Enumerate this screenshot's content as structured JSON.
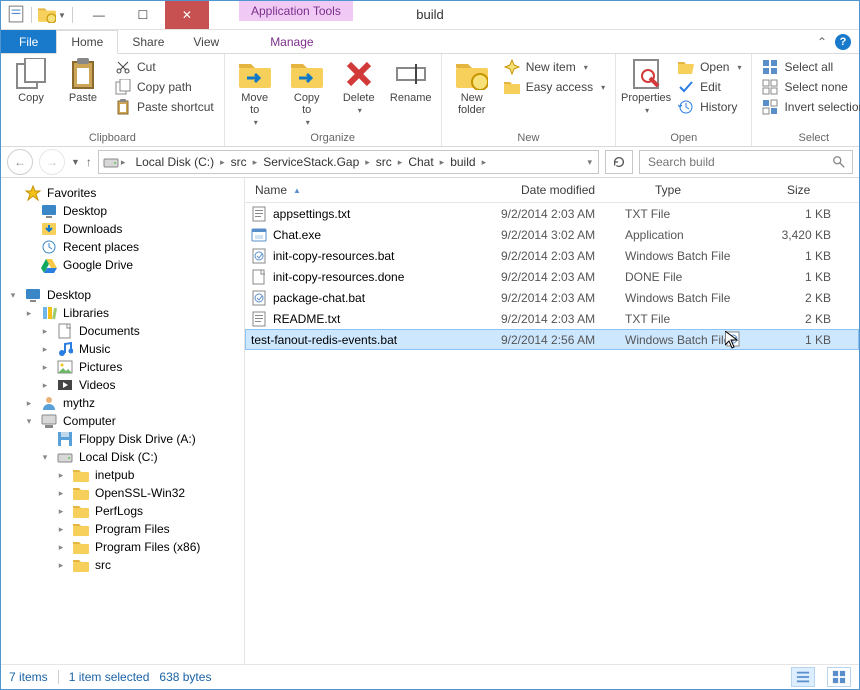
{
  "window": {
    "app_tools_label": "Application Tools",
    "title": "build"
  },
  "menubar": {
    "file": "File",
    "tabs": [
      "Home",
      "Share",
      "View"
    ],
    "manage": "Manage"
  },
  "ribbon": {
    "clipboard": {
      "label": "Clipboard",
      "copy": "Copy",
      "paste": "Paste",
      "cut": "Cut",
      "copy_path": "Copy path",
      "paste_shortcut": "Paste shortcut"
    },
    "organize": {
      "label": "Organize",
      "move_to": "Move\nto",
      "copy_to": "Copy\nto",
      "delete": "Delete",
      "rename": "Rename"
    },
    "new": {
      "label": "New",
      "new_folder": "New\nfolder",
      "new_item": "New item",
      "easy_access": "Easy access"
    },
    "open": {
      "label": "Open",
      "properties": "Properties",
      "open": "Open",
      "edit": "Edit",
      "history": "History"
    },
    "select": {
      "label": "Select",
      "select_all": "Select all",
      "select_none": "Select none",
      "invert": "Invert selection"
    }
  },
  "address": {
    "crumbs": [
      "Local Disk (C:)",
      "src",
      "ServiceStack.Gap",
      "src",
      "Chat",
      "build"
    ]
  },
  "search": {
    "placeholder": "Search build"
  },
  "nav": {
    "favorites": "Favorites",
    "fav_items": [
      "Desktop",
      "Downloads",
      "Recent places",
      "Google Drive"
    ],
    "desktop": "Desktop",
    "libraries": "Libraries",
    "lib_items": [
      "Documents",
      "Music",
      "Pictures",
      "Videos"
    ],
    "user": "mythz",
    "computer": "Computer",
    "drives": [
      "Floppy Disk Drive (A:)",
      "Local Disk (C:)"
    ],
    "c_folders": [
      "inetpub",
      "OpenSSL-Win32",
      "PerfLogs",
      "Program Files",
      "Program Files (x86)",
      "src"
    ]
  },
  "columns": {
    "name": "Name",
    "date": "Date modified",
    "type": "Type",
    "size": "Size"
  },
  "files": [
    {
      "icon": "txt",
      "name": "appsettings.txt",
      "date": "9/2/2014 2:03 AM",
      "type": "TXT File",
      "size": "1 KB"
    },
    {
      "icon": "exe",
      "name": "Chat.exe",
      "date": "9/2/2014 3:02 AM",
      "type": "Application",
      "size": "3,420 KB"
    },
    {
      "icon": "bat",
      "name": "init-copy-resources.bat",
      "date": "9/2/2014 2:03 AM",
      "type": "Windows Batch File",
      "size": "1 KB"
    },
    {
      "icon": "file",
      "name": "init-copy-resources.done",
      "date": "9/2/2014 2:03 AM",
      "type": "DONE File",
      "size": "1 KB"
    },
    {
      "icon": "bat",
      "name": "package-chat.bat",
      "date": "9/2/2014 2:03 AM",
      "type": "Windows Batch File",
      "size": "2 KB"
    },
    {
      "icon": "txt",
      "name": "README.txt",
      "date": "9/2/2014 2:03 AM",
      "type": "TXT File",
      "size": "2 KB"
    },
    {
      "icon": "bat",
      "name": "test-fanout-redis-events.bat",
      "date": "9/2/2014 2:56 AM",
      "type": "Windows Batch File",
      "size": "1 KB",
      "selected": true
    }
  ],
  "status": {
    "items": "7 items",
    "selected": "1 item selected",
    "bytes": "638 bytes"
  }
}
